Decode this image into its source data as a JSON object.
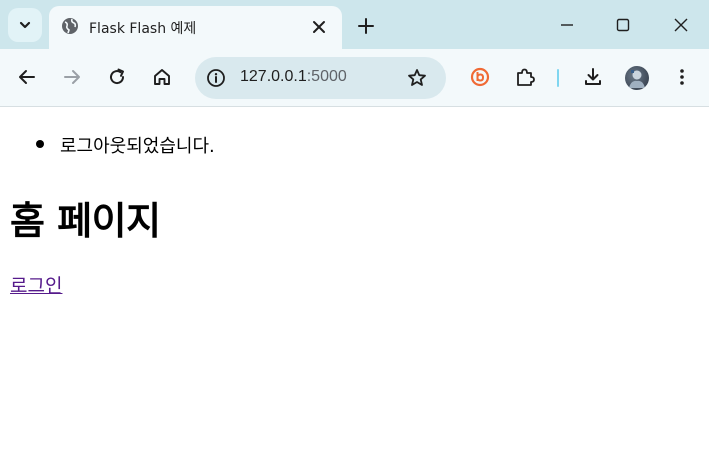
{
  "browser": {
    "tab": {
      "title": "Flask Flash 예제"
    },
    "address_bar": {
      "host": "127.0.0.1",
      "port": ":5000"
    }
  },
  "page": {
    "flash_messages": [
      "로그아웃되었습니다."
    ],
    "heading": "홈 페이지",
    "login_link": "로그인"
  },
  "colors": {
    "tabstrip": "#cde6ec",
    "toolbar": "#f3f9fb",
    "omnibox": "#d9e9ee",
    "visited_link": "#551a8b",
    "extension_accent": "#f06a35",
    "separator_accent": "#7fd6f0"
  }
}
